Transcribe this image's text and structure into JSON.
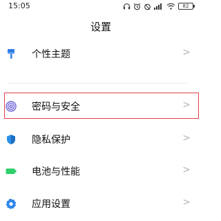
{
  "status_bar": {
    "time": "15:05",
    "battery": "82",
    "icons": [
      "headphones-icon",
      "alarm-icon",
      "timer-icon",
      "signal-icon",
      "wifi-icon",
      "battery-icon"
    ]
  },
  "page_title": "设置",
  "items": [
    {
      "label": "个性主题",
      "icon": "theme-brush-icon",
      "icon_color": "#2f7ce8"
    },
    {
      "label": "密码与安全",
      "icon": "fingerprint-icon",
      "icon_color": "#6b63d8"
    },
    {
      "label": "隐私保护",
      "icon": "privacy-shield-icon",
      "icon_color": "#2b8fe8"
    },
    {
      "label": "电池与性能",
      "icon": "battery-icon",
      "icon_color": "#2fcf6b"
    },
    {
      "label": "应用设置",
      "icon": "gear-icon",
      "icon_color": "#2f86e8"
    }
  ],
  "chevron": ">",
  "highlight_color": "#e0404a"
}
